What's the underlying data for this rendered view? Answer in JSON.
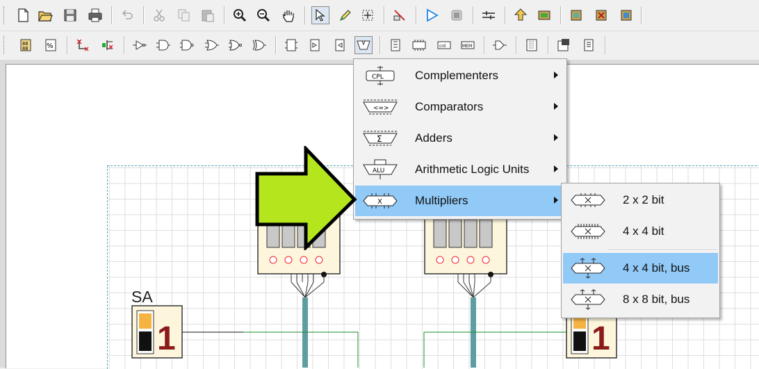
{
  "toolbar1": {
    "icons": [
      "new-file-icon",
      "open-folder-icon",
      "save-icon",
      "print-icon",
      "undo-icon",
      "cut-icon",
      "copy-icon",
      "paste-icon",
      "zoom-in-icon",
      "zoom-out-icon",
      "pan-hand-icon",
      "select-pointer-icon",
      "pencil-icon",
      "move-icon",
      "edit-tool-icon",
      "run-simulation-icon",
      "stop-simulation-icon",
      "switch-icon",
      "hierarchy-up-icon",
      "chip-icon",
      "chip-edit-icon",
      "chip-delete-icon",
      "chip-view-icon"
    ]
  },
  "toolbar2": {
    "icons": [
      "counter-icon",
      "modulo-icon",
      "wire-delete-icon",
      "connector-delete-icon",
      "buffer-icon",
      "and-gate-icon",
      "nand-gate-icon",
      "or-gate-icon",
      "nor-gate-icon",
      "xor-gate-icon",
      "flipflop-d-icon",
      "flipflop-t-icon",
      "flipflop-jk-icon",
      "arithmetic-icon",
      "register-icon",
      "rom-icon",
      "memory-icon",
      "ram-icon",
      "bus-driver-icon",
      "display-icon",
      "properties-icon",
      "documentation-icon"
    ],
    "pressed": "arithmetic-icon"
  },
  "canvas": {
    "switch_label": "SA",
    "switch_value_left": "1",
    "switch_value_right": "1"
  },
  "menu": {
    "items": [
      {
        "icon": "CPL",
        "label": "Complementers",
        "has_submenu": true
      },
      {
        "icon": "<=>",
        "label": "Comparators",
        "has_submenu": true
      },
      {
        "icon": "Σ",
        "label": "Adders",
        "has_submenu": true
      },
      {
        "icon": "ALU",
        "label": "Arithmetic Logic Units",
        "has_submenu": true
      },
      {
        "icon": "X",
        "label": "Multipliers",
        "has_submenu": true,
        "highlighted": true
      }
    ]
  },
  "submenu": {
    "items": [
      {
        "label": "2 x 2 bit"
      },
      {
        "label": "4 x 4 bit"
      },
      {
        "label": "4 x 4 bit, bus",
        "highlighted": true
      },
      {
        "label": "8 x 8 bit, bus"
      }
    ]
  },
  "colors": {
    "highlight": "#91c9f7",
    "pointer_arrow": "#b5e61d",
    "bus": "#5f9ea0",
    "wire": "#1a8c2a",
    "switch_digit": "#8b1a1a",
    "switch_orange": "#f5b342"
  }
}
